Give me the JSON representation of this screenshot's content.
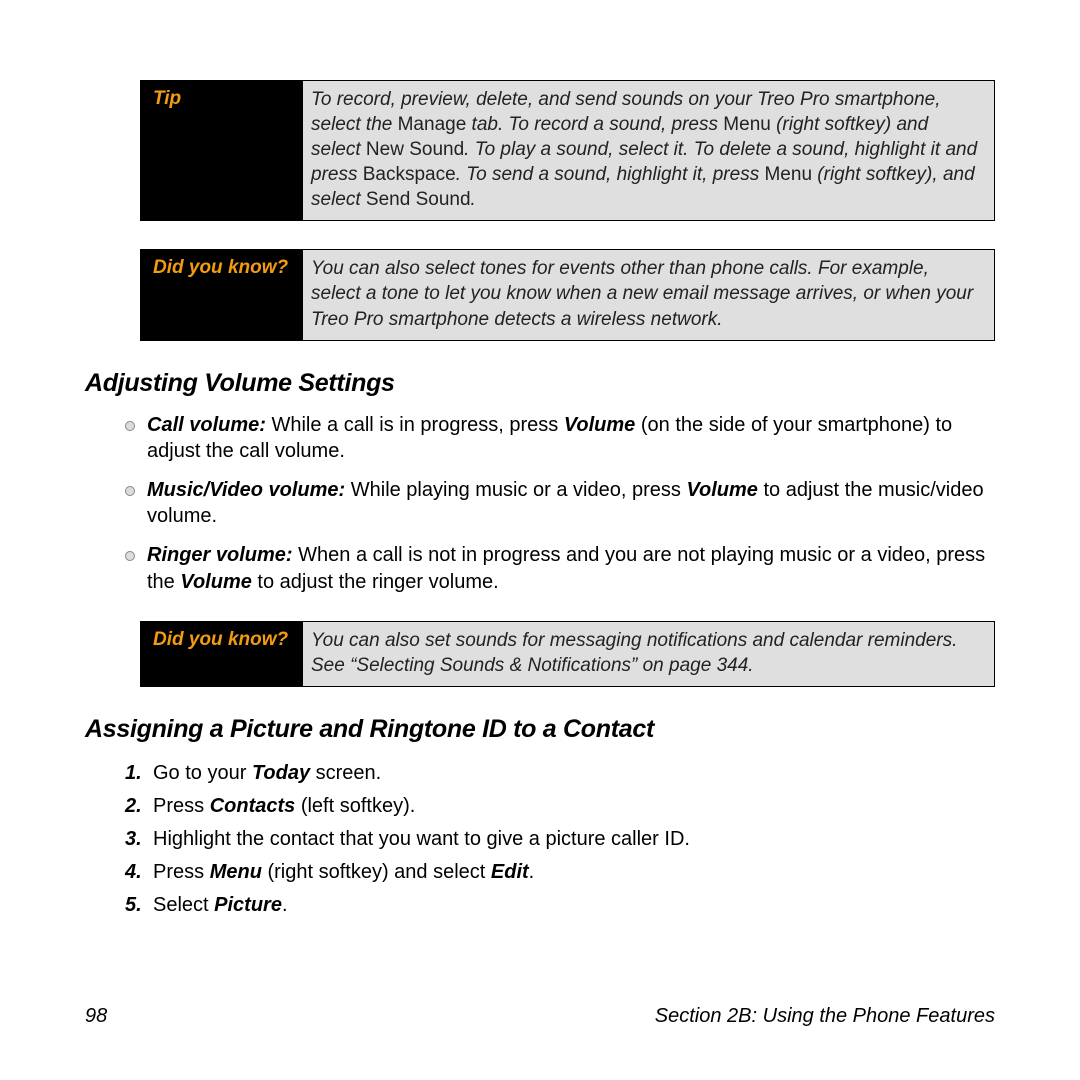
{
  "callouts": {
    "tip": {
      "label": "Tip",
      "html": "To record, preview, delete, and send sounds on your Treo Pro smartphone, select the <span class=\"upright\">Manage</span> tab. To record a sound, press <span class=\"upright\">Menu</span> (right softkey) and select <span class=\"upright\">New Sound</span>. To play a sound, select it. To delete a sound, highlight it and press <span class=\"upright\">Backspace</span>. To send a sound, highlight it, press <span class=\"upright\">Menu</span> (right softkey), and select <span class=\"upright\">Send Sound</span>."
    },
    "dyk1": {
      "label": "Did you know?",
      "html": "You can also select tones for events other than phone calls. For example, select a tone to let you know when a new email message arrives, or when your Treo Pro smartphone detects a wireless network."
    },
    "dyk2": {
      "label": "Did you know?",
      "html": "You can also set sounds for messaging notifications and calendar reminders. See “Selecting Sounds & Notifications” on page 344."
    }
  },
  "heading_volume": "Adjusting Volume Settings",
  "bullets": [
    "<span class=\"bi\">Call volume:</span> While a call is in progress, press <span class=\"bi\">Volume</span> (on the side of your smartphone) to adjust the call volume.",
    "<span class=\"bi\">Music/Video volume:</span> While playing music or a video, press <span class=\"bi\">Volume</span> to adjust the music/video volume.",
    "<span class=\"bi\">Ringer volume:</span> When a call is not in progress and you are not playing music or a video, press the <span class=\"bi\">Volume</span> to adjust the ringer volume."
  ],
  "heading_assign": "Assigning a Picture and Ringtone ID to a Contact",
  "steps": [
    "Go to your <span class=\"bi\">Today</span> screen.",
    "Press <span class=\"bi\">Contacts</span> (left softkey).",
    "Highlight the contact that you want to give a picture caller ID.",
    "Press <span class=\"bi\">Menu</span> (right softkey) and select <span class=\"bi\">Edit</span>.",
    "Select <span class=\"bi\">Picture</span>."
  ],
  "footer": {
    "page": "98",
    "section": "Section 2B: Using the Phone Features"
  }
}
